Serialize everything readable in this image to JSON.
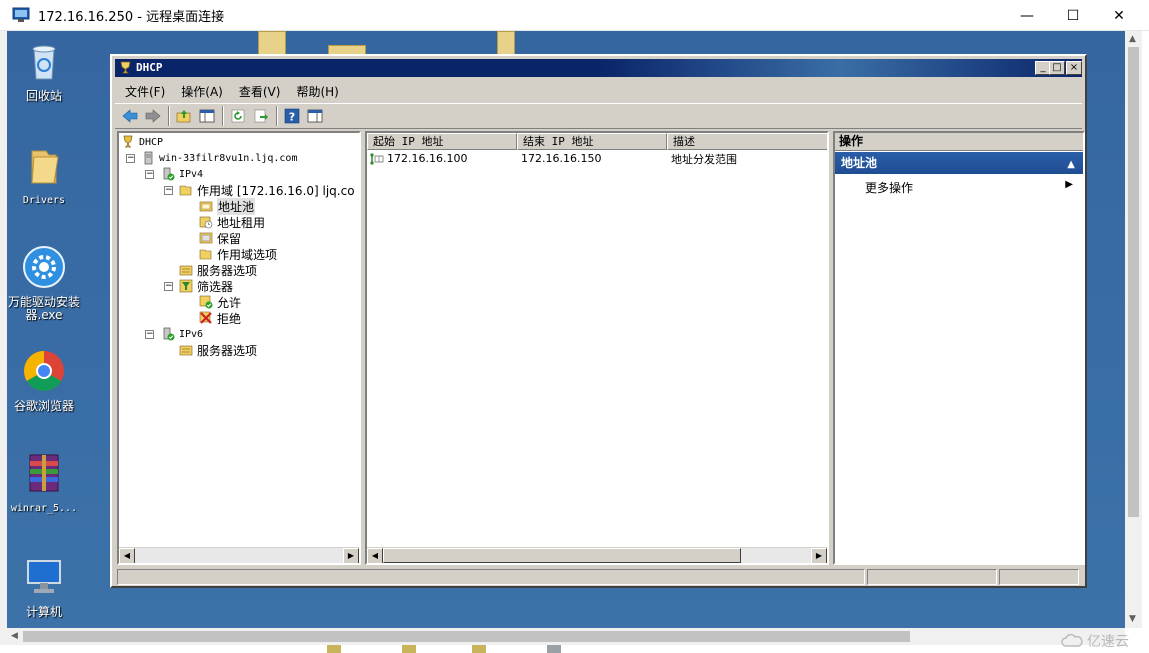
{
  "rdp": {
    "title": "172.16.16.250 - 远程桌面连接",
    "controls": {
      "minimize": "—",
      "maximize": "☐",
      "close": "✕"
    }
  },
  "desktop": {
    "icons": [
      {
        "label": "回收站",
        "icon": "recycle-bin-icon"
      },
      {
        "label": "Drivers",
        "icon": "folder-icon"
      },
      {
        "label": "万能驱动安装器.exe",
        "icon": "gear-app-icon"
      },
      {
        "label": "谷歌浏览器",
        "icon": "chrome-icon"
      },
      {
        "label": "winrar_5...",
        "icon": "winrar-icon"
      },
      {
        "label": "计算机",
        "icon": "computer-icon"
      }
    ]
  },
  "dhcp": {
    "title": "DHCP",
    "title_controls": {
      "minimize": "_",
      "maximize": "□",
      "close": "×"
    },
    "menu": [
      "文件(F)",
      "操作(A)",
      "查看(V)",
      "帮助(H)"
    ],
    "tree": {
      "root": "DHCP",
      "server": "win-33filr8vu1n.ljq.com",
      "ipv4": "IPv4",
      "scope": "作用域 [172.16.16.0] ljq.co",
      "address_pool": "地址池",
      "address_leases": "地址租用",
      "reservations": "保留",
      "scope_options": "作用域选项",
      "server_options_v4": "服务器选项",
      "filters": "筛选器",
      "allow": "允许",
      "deny": "拒绝",
      "ipv6": "IPv6",
      "server_options_v6": "服务器选项"
    },
    "list": {
      "columns": [
        "起始 IP 地址",
        "结束 IP 地址",
        "描述"
      ],
      "rows": [
        {
          "start": "172.16.16.100",
          "end": "172.16.16.150",
          "desc": "地址分发范围"
        }
      ]
    },
    "actions": {
      "header": "操作",
      "section": "地址池",
      "more": "更多操作"
    }
  },
  "watermark": "亿速云"
}
